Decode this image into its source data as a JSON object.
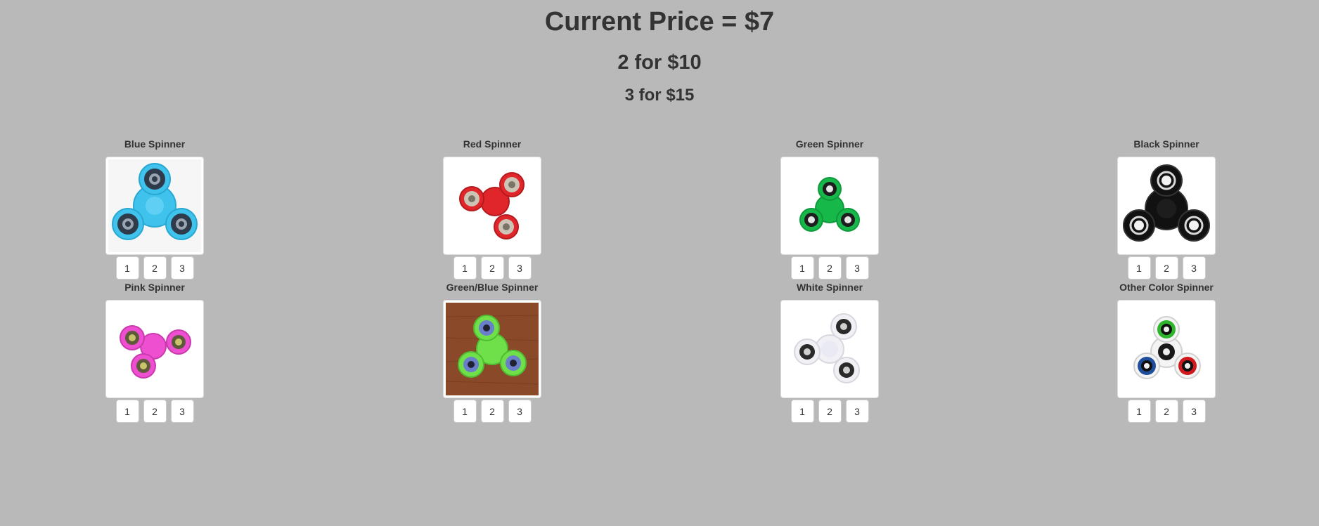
{
  "header": {
    "current_price": "Current Price = $7",
    "deal_two": "2 for $10",
    "deal_three": "3 for $15"
  },
  "products": [
    {
      "name": "Blue Spinner",
      "image": "blue-spinner",
      "color": "#3fc2ec",
      "quantities": [
        "1",
        "2",
        "3"
      ]
    },
    {
      "name": "Red Spinner",
      "image": "red-spinner",
      "color": "#e0262a",
      "quantities": [
        "1",
        "2",
        "3"
      ]
    },
    {
      "name": "Green Spinner",
      "image": "green-spinner",
      "color": "#17b84a",
      "quantities": [
        "1",
        "2",
        "3"
      ]
    },
    {
      "name": "Black Spinner",
      "image": "black-spinner",
      "color": "#111111",
      "quantities": [
        "1",
        "2",
        "3"
      ]
    },
    {
      "name": "Pink Spinner",
      "image": "pink-spinner",
      "color": "#ee4fd0",
      "quantities": [
        "1",
        "2",
        "3"
      ]
    },
    {
      "name": "Green/Blue Spinner",
      "image": "green-blue-spinner",
      "color": "#6fe04a",
      "quantities": [
        "1",
        "2",
        "3"
      ]
    },
    {
      "name": "White Spinner",
      "image": "white-spinner",
      "color": "#f1f1f5",
      "quantities": [
        "1",
        "2",
        "3"
      ]
    },
    {
      "name": "Other Color Spinner",
      "image": "multi-color-spinner",
      "color": "#ffffff",
      "quantities": [
        "1",
        "2",
        "3"
      ]
    }
  ]
}
